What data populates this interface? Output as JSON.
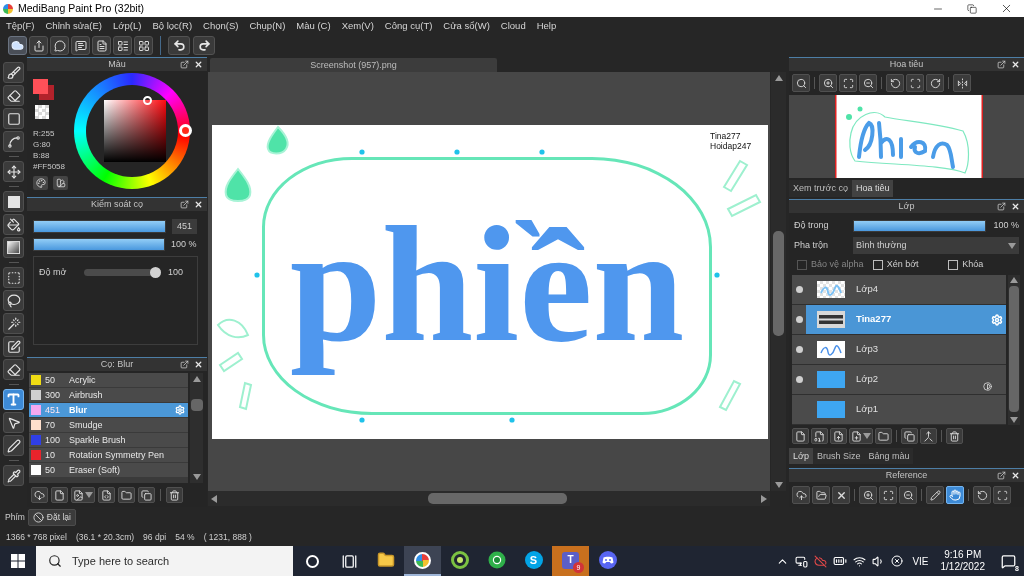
{
  "window": {
    "title": "MediBang Paint Pro (32bit)"
  },
  "menu": [
    "Tệp(F)",
    "Chỉnh sửa(E)",
    "Lớp(L)",
    "Bộ lọc(R)",
    "Chọn(S)",
    "Chụp(N)",
    "Màu (C)",
    "Xem(V)",
    "Công cụ(T)",
    "Cửa sổ(W)",
    "Cloud",
    "Help"
  ],
  "tool_groups": [
    [
      {
        "kind": "brush",
        "selected": false
      },
      {
        "kind": "eraser",
        "selected": false
      },
      {
        "kind": "shape",
        "selected": false
      },
      {
        "kind": "polyline",
        "selected": false
      }
    ],
    [
      {
        "kind": "move",
        "selected": false
      }
    ],
    [
      {
        "kind": "fill",
        "selected": false
      },
      {
        "kind": "bucket",
        "selected": false
      },
      {
        "kind": "gradient",
        "selected": false
      }
    ],
    [
      {
        "kind": "marquee",
        "selected": false
      },
      {
        "kind": "lasso",
        "selected": false
      },
      {
        "kind": "wand",
        "selected": false
      },
      {
        "kind": "selectpen",
        "selected": false
      },
      {
        "kind": "selecteraser",
        "selected": false
      }
    ],
    [
      {
        "kind": "text",
        "selected": true
      },
      {
        "kind": "operation",
        "selected": false
      },
      {
        "kind": "pen",
        "selected": false
      }
    ],
    [
      {
        "kind": "dropper",
        "selected": false
      }
    ]
  ],
  "color_panel": {
    "title": "Màu",
    "swatches": [
      {
        "kind": "main",
        "color": "#ff5058"
      },
      {
        "kind": "sub",
        "color": "#b3222b"
      }
    ],
    "readout": [
      "R:255",
      "G:80",
      "B:88",
      "#FF5058"
    ]
  },
  "brush_control": {
    "title": "Kiểm soát cọ",
    "size": {
      "level": 1,
      "value": "451"
    },
    "opacity": {
      "level": 1,
      "value": "100 %"
    },
    "blur": {
      "label": "Độ mở",
      "level": 1,
      "value": "100"
    }
  },
  "brush_list": {
    "title": "Cọ: Blur",
    "items": [
      {
        "color": "#f0dc14",
        "size": "50",
        "name": "Acrylic",
        "selected": false
      },
      {
        "color": "#cfcfcf",
        "size": "300",
        "name": "Airbrush",
        "selected": false
      },
      {
        "color": "#f5a8f0",
        "size": "451",
        "name": "Blur",
        "selected": true
      },
      {
        "color": "#ffe0cc",
        "size": "70",
        "name": "Smudge",
        "selected": false
      },
      {
        "color": "#2f3fe6",
        "size": "100",
        "name": "Sparkle Brush",
        "selected": false
      },
      {
        "color": "#e8242c",
        "size": "10",
        "name": "Rotation Symmetry Pen",
        "selected": false
      },
      {
        "color": "#ffffff",
        "size": "50",
        "name": "Eraser (Soft)",
        "selected": false
      }
    ]
  },
  "document": {
    "tab": "Screenshot (957).png",
    "lettering": "phiền",
    "signature": [
      "Tina277",
      "Hoidap247"
    ]
  },
  "navigator": {
    "title": "Hoa tiêu",
    "tabs": [
      {
        "label": "Xem trước cọ",
        "selected": false
      },
      {
        "label": "Hoa tiêu",
        "selected": true
      }
    ]
  },
  "layer_panel": {
    "title": "Lớp",
    "opacity": {
      "label": "Độ trong",
      "level": 1,
      "value": "100 %"
    },
    "blend": {
      "label": "Pha trộn",
      "value": "Bình thường"
    },
    "options": [
      {
        "label": "Bảo vệ alpha",
        "checked": false,
        "disabled": true
      },
      {
        "label": "Xén bớt",
        "checked": false,
        "disabled": false
      },
      {
        "label": "Khóa",
        "checked": false,
        "disabled": false
      }
    ],
    "layers": [
      {
        "name": "Lớp4",
        "kind": "sketch",
        "visible": true,
        "selected": false,
        "marked": false
      },
      {
        "name": "Tina277",
        "kind": "text",
        "visible": true,
        "selected": true,
        "marked": false
      },
      {
        "name": "Lớp3",
        "kind": "lettering",
        "visible": true,
        "selected": false,
        "marked": false
      },
      {
        "name": "Lớp2",
        "kind": "fill",
        "visible": true,
        "selected": false,
        "marked": true
      },
      {
        "name": "Lớp1",
        "kind": "fill",
        "visible": false,
        "selected": false,
        "marked": false
      }
    ],
    "tabs": [
      {
        "label": "Lớp",
        "selected": true
      },
      {
        "label": "Brush Size",
        "selected": false
      },
      {
        "label": "Bảng màu",
        "selected": false
      }
    ]
  },
  "reference": {
    "title": "Reference",
    "tool_groups": [
      [
        {
          "kind": "upload",
          "selected": false
        },
        {
          "kind": "folder",
          "selected": false
        },
        {
          "kind": "close",
          "selected": false
        }
      ],
      [
        {
          "kind": "zoomin",
          "selected": false
        },
        {
          "kind": "fit",
          "selected": false
        },
        {
          "kind": "zoomout",
          "selected": false
        }
      ],
      [
        {
          "kind": "pen",
          "selected": false
        },
        {
          "kind": "hand",
          "selected": true
        }
      ],
      [
        {
          "kind": "rotate",
          "selected": false
        },
        {
          "kind": "center",
          "selected": false
        }
      ]
    ]
  },
  "keys": {
    "label": "Phím",
    "reset": "Đặt lại"
  },
  "status_bar": [
    "1366 * 768 pixel",
    "(36.1 * 20.3cm)",
    "96 dpi",
    "54 %",
    "( 1231, 888 )"
  ],
  "taskbar": {
    "search": {
      "placeholder": "Type here to search"
    },
    "apps": [
      {
        "kind": "explorer",
        "active": false,
        "attention": false
      },
      {
        "kind": "paint",
        "active": true,
        "attention": false
      },
      {
        "kind": "swirl",
        "active": false,
        "attention": false
      },
      {
        "kind": "globe",
        "active": false,
        "attention": false
      },
      {
        "kind": "chat",
        "glyph": "S",
        "active": false,
        "attention": false
      },
      {
        "kind": "team",
        "glyph": "T",
        "badge": "9",
        "active": false,
        "attention": true
      },
      {
        "kind": "controller",
        "active": false,
        "attention": false
      }
    ],
    "language": "VIE",
    "time": "9:16 PM",
    "date": "1/12/2022",
    "notifications": "8"
  }
}
